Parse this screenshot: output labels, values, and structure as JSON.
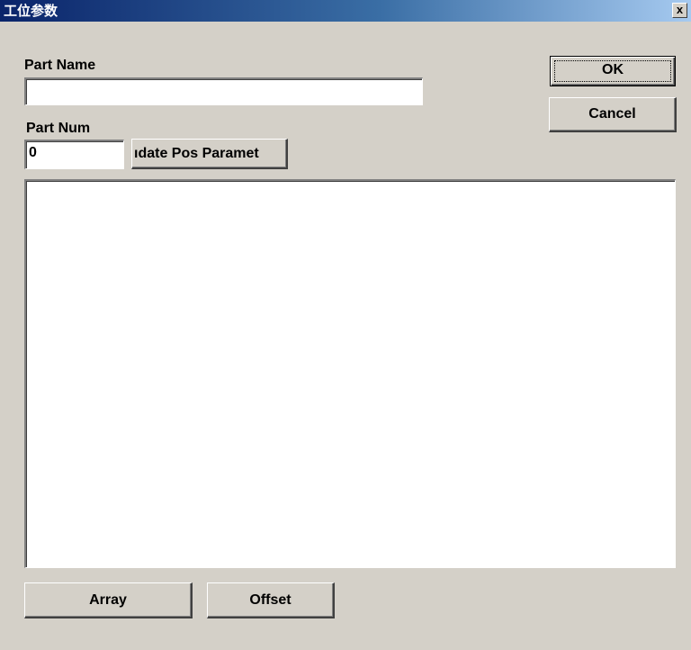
{
  "window": {
    "title": "工位参数",
    "close_glyph": "x"
  },
  "form": {
    "part_name_label": "Part Name",
    "part_name_value": "",
    "part_num_label": "Part Num",
    "part_num_value": "0",
    "update_button_label": "ıdate Pos Paramet"
  },
  "buttons": {
    "ok": "OK",
    "cancel": "Cancel",
    "array": "Array",
    "offset": "Offset"
  },
  "list": {
    "items": []
  },
  "colors": {
    "dialog_bg": "#d4d0c8",
    "titlebar_start": "#0a246a",
    "titlebar_end": "#a6caf0"
  }
}
